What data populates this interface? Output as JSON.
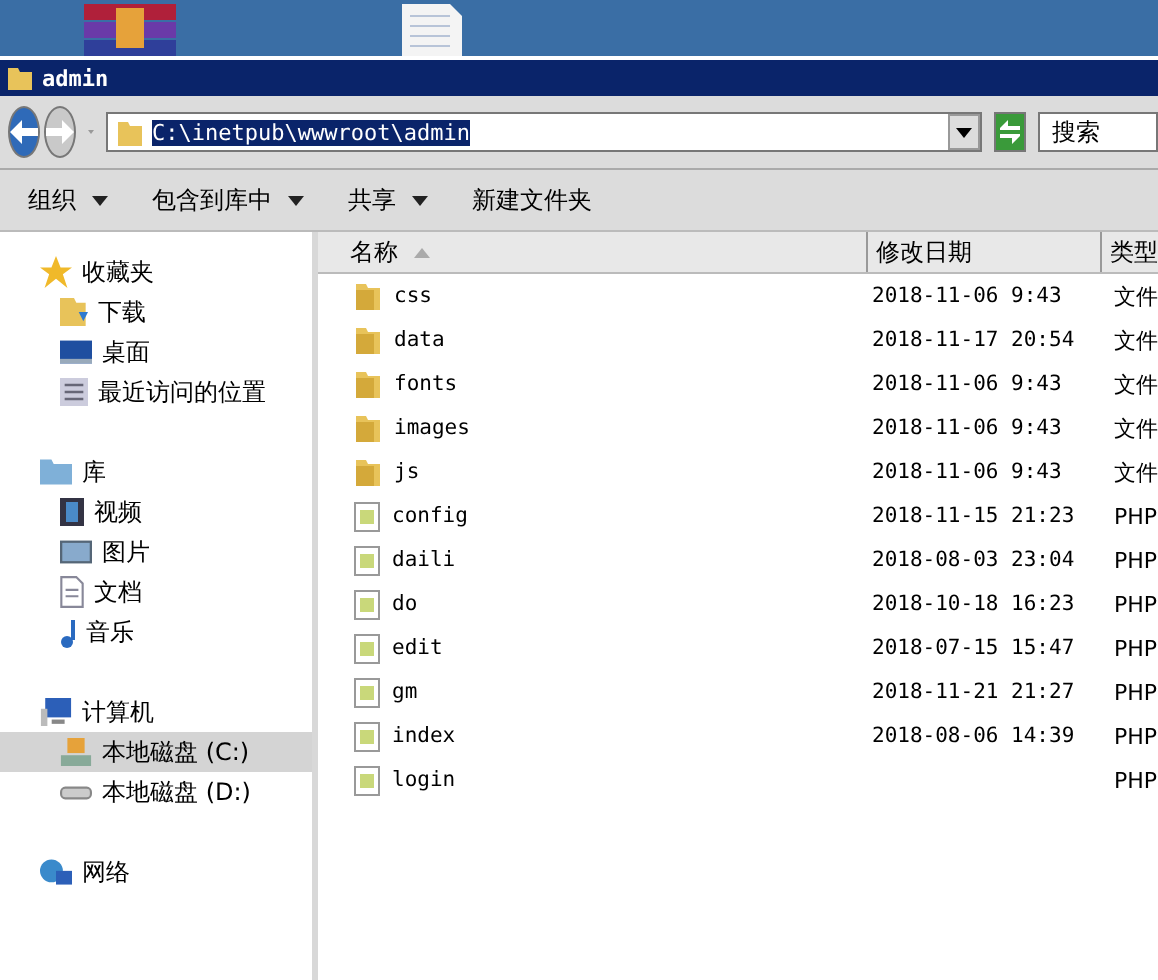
{
  "window": {
    "title": "admin"
  },
  "address": {
    "path": "C:\\inetpub\\wwwroot\\admin",
    "search_placeholder": "搜索"
  },
  "toolbar": [
    {
      "label": "组织",
      "dropdown": true
    },
    {
      "label": "包含到库中",
      "dropdown": true
    },
    {
      "label": "共享",
      "dropdown": true
    },
    {
      "label": "新建文件夹",
      "dropdown": false
    }
  ],
  "sidebar": {
    "groups": [
      {
        "label": "收藏夹",
        "items": [
          {
            "label": "下载",
            "selected": false
          },
          {
            "label": "桌面",
            "selected": false
          },
          {
            "label": "最近访问的位置",
            "selected": false
          }
        ]
      },
      {
        "label": "库",
        "items": [
          {
            "label": "视频",
            "selected": false
          },
          {
            "label": "图片",
            "selected": false
          },
          {
            "label": "文档",
            "selected": false
          },
          {
            "label": "音乐",
            "selected": false
          }
        ]
      },
      {
        "label": "计算机",
        "items": [
          {
            "label": "本地磁盘 (C:)",
            "selected": true
          },
          {
            "label": "本地磁盘 (D:)",
            "selected": false
          }
        ]
      },
      {
        "label": "网络"
      }
    ]
  },
  "table": {
    "columns": [
      "名称",
      "修改日期",
      "类型"
    ],
    "rows": [
      {
        "kind": "folder",
        "name": "css",
        "date": "2018-11-06 9:43",
        "type": "文件"
      },
      {
        "kind": "folder",
        "name": "data",
        "date": "2018-11-17 20:54",
        "type": "文件"
      },
      {
        "kind": "folder",
        "name": "fonts",
        "date": "2018-11-06 9:43",
        "type": "文件"
      },
      {
        "kind": "folder",
        "name": "images",
        "date": "2018-11-06 9:43",
        "type": "文件"
      },
      {
        "kind": "folder",
        "name": "js",
        "date": "2018-11-06 9:43",
        "type": "文件"
      },
      {
        "kind": "php",
        "name": "config",
        "date": "2018-11-15 21:23",
        "type": "PHP"
      },
      {
        "kind": "php",
        "name": "daili",
        "date": "2018-08-03 23:04",
        "type": "PHP"
      },
      {
        "kind": "php",
        "name": "do",
        "date": "2018-10-18 16:23",
        "type": "PHP"
      },
      {
        "kind": "php",
        "name": "edit",
        "date": "2018-07-15 15:47",
        "type": "PHP"
      },
      {
        "kind": "php",
        "name": "gm",
        "date": "2018-11-21 21:27",
        "type": "PHP"
      },
      {
        "kind": "php",
        "name": "index",
        "date": "2018-08-06 14:39",
        "type": "PHP"
      },
      {
        "kind": "php",
        "name": "login",
        "type": "PHP"
      }
    ]
  }
}
